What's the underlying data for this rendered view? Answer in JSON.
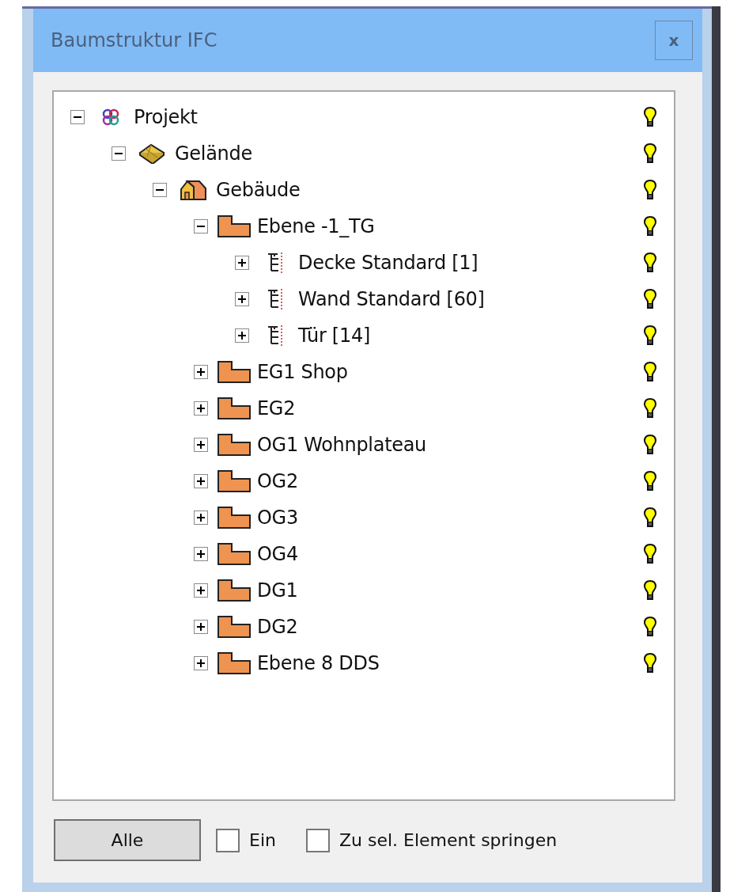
{
  "window": {
    "title": "Baumstruktur IFC",
    "close_label": "x"
  },
  "tree": [
    {
      "label": "Projekt",
      "kind": "project",
      "expanded": true,
      "visible": true,
      "children": [
        {
          "label": "Gelände",
          "kind": "site",
          "expanded": true,
          "visible": true,
          "children": [
            {
              "label": "Gebäude",
              "kind": "building",
              "expanded": true,
              "visible": true,
              "children": [
                {
                  "label": "Ebene -1_TG",
                  "kind": "storey",
                  "expanded": true,
                  "visible": true,
                  "children": [
                    {
                      "label": "Decke Standard [1]",
                      "kind": "group",
                      "expanded": false,
                      "visible": true
                    },
                    {
                      "label": "Wand Standard [60]",
                      "kind": "group",
                      "expanded": false,
                      "visible": true
                    },
                    {
                      "label": "Tür [14]",
                      "kind": "group",
                      "expanded": false,
                      "visible": true
                    }
                  ]
                },
                {
                  "label": "EG1 Shop",
                  "kind": "storey",
                  "expanded": false,
                  "visible": true
                },
                {
                  "label": "EG2",
                  "kind": "storey",
                  "expanded": false,
                  "visible": true
                },
                {
                  "label": "OG1 Wohnplateau",
                  "kind": "storey",
                  "expanded": false,
                  "visible": true
                },
                {
                  "label": "OG2",
                  "kind": "storey",
                  "expanded": false,
                  "visible": true
                },
                {
                  "label": "OG3",
                  "kind": "storey",
                  "expanded": false,
                  "visible": true
                },
                {
                  "label": "OG4",
                  "kind": "storey",
                  "expanded": false,
                  "visible": true
                },
                {
                  "label": "DG1",
                  "kind": "storey",
                  "expanded": false,
                  "visible": true
                },
                {
                  "label": "DG2",
                  "kind": "storey",
                  "expanded": false,
                  "visible": true
                },
                {
                  "label": "Ebene 8 DDS",
                  "kind": "storey",
                  "expanded": false,
                  "visible": true
                }
              ]
            }
          ]
        }
      ]
    }
  ],
  "footer": {
    "button": "Alle",
    "checkboxes": [
      {
        "label": "Ein",
        "checked": false
      },
      {
        "label": "Zu sel. Element springen",
        "checked": false
      }
    ]
  }
}
